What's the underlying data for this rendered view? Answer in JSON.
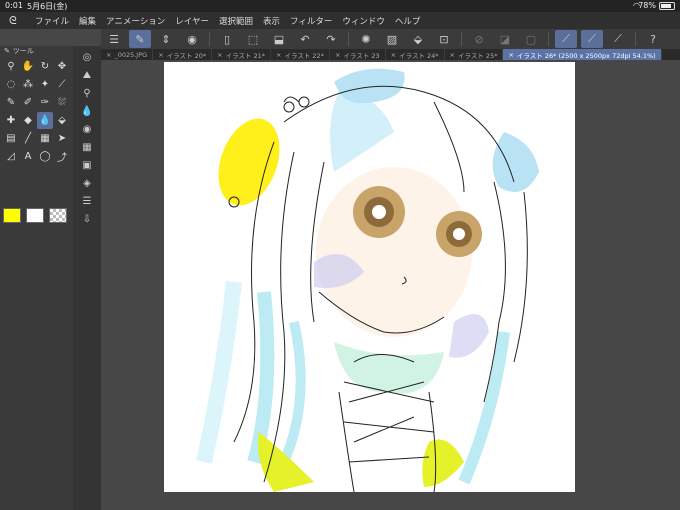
{
  "status": {
    "time": "0:01",
    "date": "5月6日(金)",
    "battery": "78%"
  },
  "menu": {
    "items": [
      "ファイル",
      "編集",
      "アニメーション",
      "レイヤー",
      "選択範囲",
      "表示",
      "フィルター",
      "ウィンドウ",
      "ヘルプ"
    ]
  },
  "panel": {
    "title": "ツール"
  },
  "tabs": [
    {
      "label": "_0025.JPG"
    },
    {
      "label": "イラスト 20*"
    },
    {
      "label": "イラスト 21*"
    },
    {
      "label": "イラスト 22*"
    },
    {
      "label": "イラスト 23"
    },
    {
      "label": "イラスト 24*"
    },
    {
      "label": "イラスト 25*"
    },
    {
      "label": "イラスト 26* (2500 x 2500px 72dpi 54.1%)"
    }
  ],
  "colors": {
    "main": "#ffff00",
    "sub": "#ffffff",
    "accent": "#5b74a8"
  },
  "tools": [
    "zoom-icon",
    "hand-icon",
    "rotate-icon",
    "move-icon",
    "lasso-icon",
    "magic-wand-icon",
    "sparkle-icon",
    "eyedropper-icon",
    "pen-icon",
    "marker-icon",
    "brush-icon",
    "airbrush-icon",
    "decoration-icon",
    "eraser-icon",
    "blend-icon",
    "fill-icon",
    "gradient-icon",
    "line-icon",
    "frame-icon",
    "operation-icon",
    "ruler-icon",
    "text-icon",
    "balloon-icon",
    "correction-icon"
  ]
}
